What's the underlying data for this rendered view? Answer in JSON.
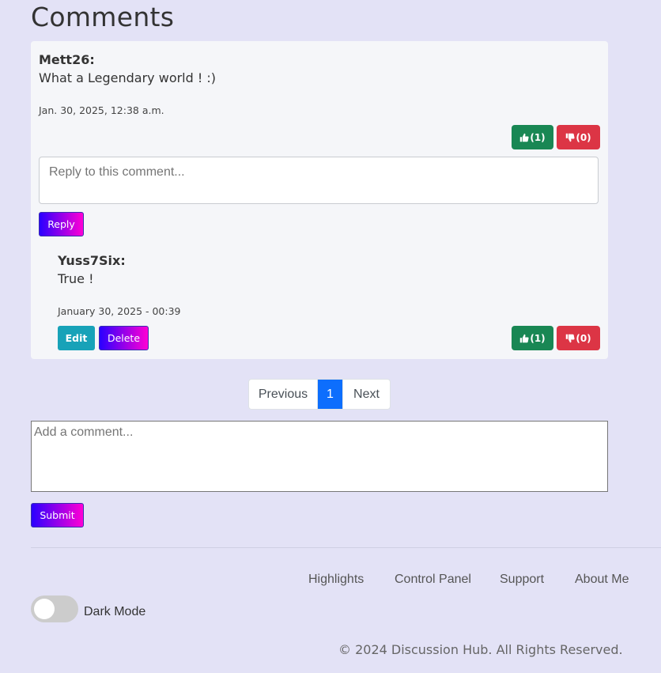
{
  "page": {
    "title": "Comments"
  },
  "comment": {
    "author": "Mett26:",
    "text": "What a Legendary world ! :)",
    "timestamp": "Jan. 30, 2025, 12:38 a.m.",
    "likes": "(1)",
    "dislikes": "(0)",
    "reply_placeholder": "Reply to this comment...",
    "reply_button": "Reply"
  },
  "reply": {
    "author": "Yuss7Six:",
    "text": "True !",
    "timestamp": "January 30, 2025 - 00:39",
    "edit_button": "Edit",
    "delete_button": "Delete",
    "likes": "(1)",
    "dislikes": "(0)"
  },
  "pagination": {
    "previous": "Previous",
    "current": "1",
    "next": "Next"
  },
  "new_comment": {
    "placeholder": "Add a comment...",
    "submit": "Submit"
  },
  "footer": {
    "links": [
      "Highlights",
      "Control Panel",
      "Support",
      "About Me"
    ],
    "dark_mode_label": "Dark Mode",
    "dark_mode_on": false,
    "copyright": "© 2024 Discussion Hub. All Rights Reserved."
  },
  "colors": {
    "background": "#e3e2f6",
    "like": "#198754",
    "dislike": "#dc3545",
    "edit": "#17a2b8",
    "active_page": "#0d6efd",
    "gradient_start": "#2a00ff",
    "gradient_end": "#ff00d4"
  },
  "icons": {
    "like": "thumbs-up-icon",
    "dislike": "thumbs-down-icon"
  }
}
